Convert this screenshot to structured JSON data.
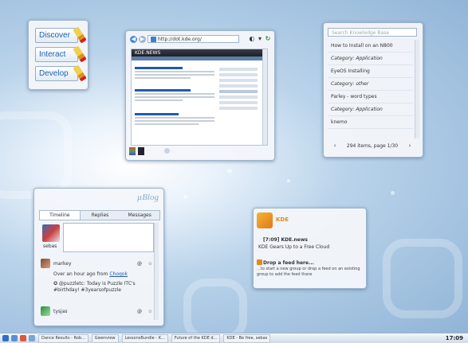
{
  "desktop": {
    "launcher": {
      "items": [
        "Discover",
        "Interact",
        "Develop"
      ]
    },
    "browser": {
      "url": "http://dot.kde.org/",
      "site_banner": "KDE.NEWS"
    },
    "knowledge_base": {
      "search_placeholder": "Search Knowledge Base",
      "items": [
        "How to Install on an N800",
        "Category: Application",
        "EyeOS Installing",
        "Category: other",
        "Parley - word types",
        "Category: Application",
        "knemo"
      ],
      "pager": "294 items, page 1/30",
      "prev": "‹",
      "next": "›"
    },
    "microblog": {
      "logo": "µBlog",
      "tabs": [
        "Timeline",
        "Replies",
        "Messages"
      ],
      "own_name": "sebas",
      "posts": [
        {
          "author": "markey",
          "reply": "@",
          "star": "☆",
          "time_text": "Over an hour ago from",
          "source": "Choqok",
          "text": "✪ @puzzletc: Today is Puzzle ITC's #birthday! #3yearsofpuzzle"
        },
        {
          "author": "tysjas",
          "reply": "@",
          "star": "☆"
        }
      ]
    },
    "news": {
      "logo": "KDE",
      "source": "[7:09] KDE.news",
      "headline": "KDE Gears Up to a Free Cloud",
      "drop_title": "Drop a feed here...",
      "drop_sub": "...to start a new group or drop a feed on an existing group to add the feed there"
    }
  },
  "panel": {
    "tasks": [
      "Dance Results - Rob...",
      "Gwenview",
      "LessonsBundle - K...",
      "Future of the KDE d...",
      "KDE - Be free, sebas"
    ],
    "clock": "17:09"
  }
}
